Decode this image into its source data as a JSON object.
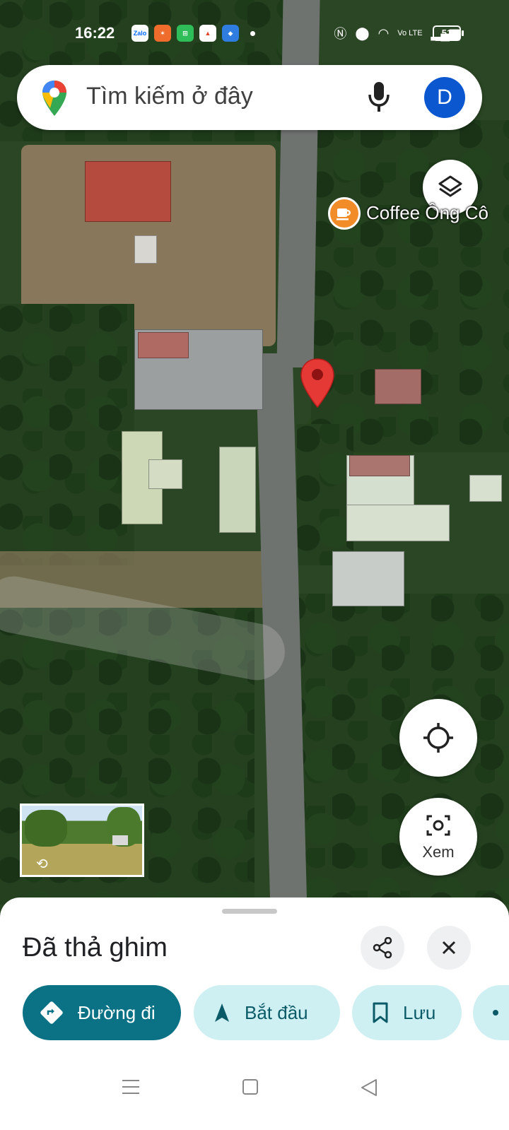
{
  "status_bar": {
    "time": "16:22",
    "app_icons": [
      "zalo-icon",
      "app-orange-icon",
      "app-green-icon",
      "app-red-icon",
      "app-blue-icon"
    ],
    "zalo_text": "Zalo",
    "network": "Vo LTE",
    "battery": "51"
  },
  "search": {
    "placeholder": "Tìm kiếm ở đây",
    "avatar_initial": "D"
  },
  "map": {
    "poi_label": "Coffee Ông Cô",
    "view_button_label": "Xem"
  },
  "sheet": {
    "title": "Đã thả ghim",
    "chips": {
      "directions": "Đường đi",
      "start": "Bắt đầu",
      "save": "Lưu"
    }
  },
  "colors": {
    "primary_chip": "#0b7285",
    "secondary_chip": "#cff0f3",
    "pin_red": "#e53935",
    "coffee_orange": "#f28c28",
    "avatar_blue": "#0b57d0"
  }
}
